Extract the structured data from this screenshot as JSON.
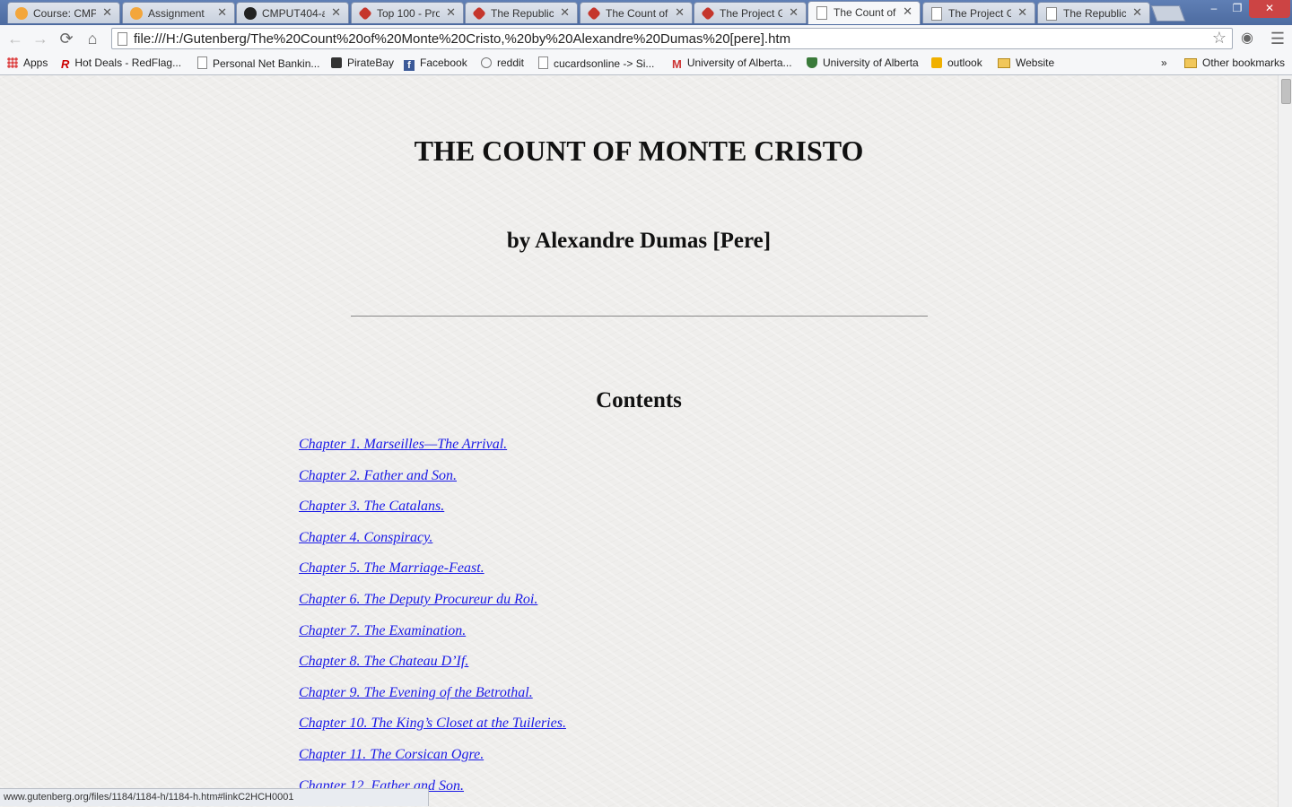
{
  "tabs": [
    {
      "title": "Course: CMP",
      "icon": "moodle-icon",
      "active": false
    },
    {
      "title": "Assignment",
      "icon": "moodle-icon",
      "active": false
    },
    {
      "title": "CMPUT404-a",
      "icon": "github-icon",
      "active": false
    },
    {
      "title": "Top 100 - Pro",
      "icon": "gutenberg-icon",
      "active": false
    },
    {
      "title": "The Republic",
      "icon": "gutenberg-icon",
      "active": false
    },
    {
      "title": "The Count of",
      "icon": "gutenberg-icon",
      "active": false
    },
    {
      "title": "The Project G",
      "icon": "gutenberg-icon",
      "active": false
    },
    {
      "title": "The Count of",
      "icon": "page-icon",
      "active": true
    },
    {
      "title": "The Project G",
      "icon": "page-icon",
      "active": false
    },
    {
      "title": "The Republic",
      "icon": "page-icon",
      "active": false
    }
  ],
  "address_bar": {
    "url": "file:///H:/Gutenberg/The%20Count%20of%20Monte%20Cristo,%20by%20Alexandre%20Dumas%20[pere].htm"
  },
  "bookmarks": [
    {
      "label": "Apps",
      "icon": "apps-icon"
    },
    {
      "label": "Hot Deals - RedFlag...",
      "icon": "redflag-icon"
    },
    {
      "label": "Personal Net Bankin...",
      "icon": "page-icon"
    },
    {
      "label": "PirateBay",
      "icon": "piratebay-icon"
    },
    {
      "label": "Facebook",
      "icon": "facebook-icon"
    },
    {
      "label": "reddit",
      "icon": "reddit-icon"
    },
    {
      "label": "cucardsonline -> Si...",
      "icon": "page-icon"
    },
    {
      "label": "University of Alberta...",
      "icon": "gmail-icon"
    },
    {
      "label": "University of Alberta",
      "icon": "ualberta-icon"
    },
    {
      "label": "outlook",
      "icon": "outlook-icon"
    },
    {
      "label": "Website",
      "icon": "folder-icon"
    }
  ],
  "bookmarks_overflow": "»",
  "other_bookmarks": "Other bookmarks",
  "page": {
    "title": "THE COUNT OF MONTE CRISTO",
    "author": "by Alexandre Dumas [Pere]",
    "contents_heading": "Contents",
    "chapters": [
      "Chapter 1. Marseilles—The Arrival.",
      "Chapter 2. Father and Son.",
      "Chapter 3. The Catalans.",
      "Chapter 4. Conspiracy.",
      "Chapter 5. The Marriage-Feast.",
      "Chapter 6. The Deputy Procureur du Roi.",
      "Chapter 7. The Examination.",
      "Chapter 8. The Chateau D’If.",
      "Chapter 9. The Evening of the Betrothal.",
      "Chapter 10. The King’s Closet at the Tuileries.",
      "Chapter 11. The Corsican Ogre.",
      "Chapter 12. Father and Son."
    ]
  },
  "status_bar": {
    "text": "www.gutenberg.org/files/1184/1184-h/1184-h.htm#linkC2HCH0001"
  },
  "colors": {
    "link": "#1a1ae6",
    "tabstrip": "#5f7fb5",
    "page_background": "#efeeec"
  }
}
